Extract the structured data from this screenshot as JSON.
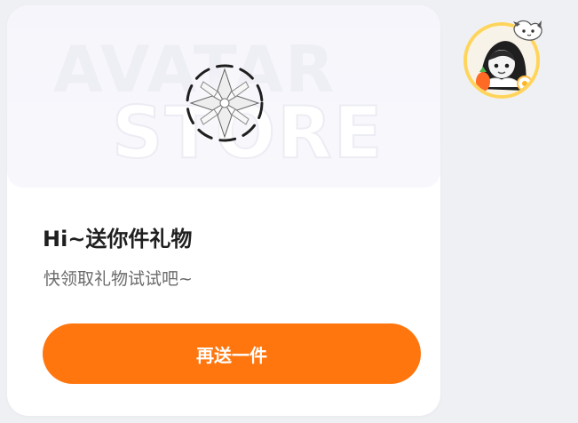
{
  "card": {
    "banner_watermark_top": "AVATAR",
    "banner_watermark_bottom": "STORE",
    "title": "Hi~送你件礼物",
    "subtitle": "快领取礼物试试吧~",
    "button_label": "再送一件"
  },
  "avatar": {
    "icon": "profile-avatar-icon"
  },
  "colors": {
    "page_background": "#eff0f4",
    "card_background": "#ffffff",
    "accent_orange": "#ff760f",
    "title_text": "#1f1f1f",
    "subtitle_text": "#6b6b6b"
  }
}
